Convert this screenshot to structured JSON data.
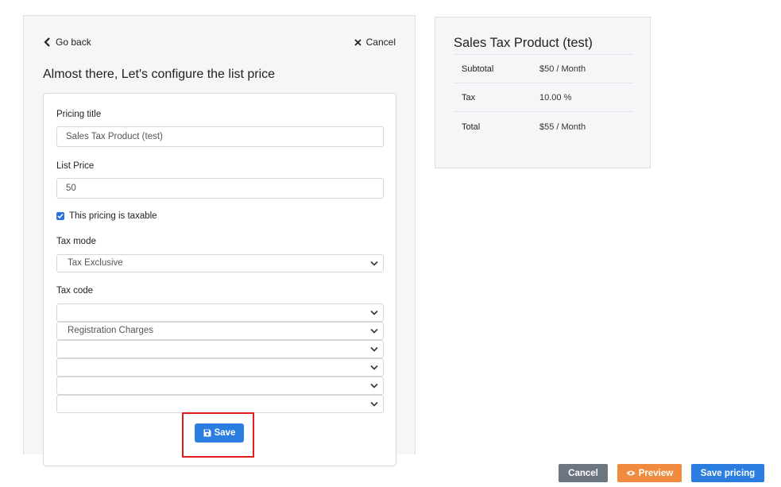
{
  "nav": {
    "go_back": "Go back",
    "cancel": "Cancel"
  },
  "page_title": "Almost there, Let's configure the list price",
  "form": {
    "pricing_title_label": "Pricing title",
    "pricing_title_value": "Sales Tax Product (test)",
    "list_price_label": "List Price",
    "list_price_value": "50",
    "taxable_label": "This pricing is taxable",
    "taxable_checked": true,
    "tax_mode_label": "Tax mode",
    "tax_mode_value": "Tax Exclusive",
    "tax_code_label": "Tax code",
    "tax_codes": [
      "",
      "Registration Charges",
      "",
      "",
      "",
      ""
    ],
    "save_label": "Save"
  },
  "summary": {
    "title": "Sales Tax Product (test)",
    "rows": [
      {
        "label": "Subtotal",
        "value": "$50 / Month"
      },
      {
        "label": "Tax",
        "value": "10.00 %"
      },
      {
        "label": "Total",
        "value": "$55 / Month"
      }
    ]
  },
  "footer": {
    "cancel": "Cancel",
    "preview": "Preview",
    "save_pricing": "Save pricing"
  },
  "colors": {
    "primary": "#2b7de0",
    "preview": "#f08a3e",
    "cancel": "#6c7680",
    "highlight": "#e01b1b"
  }
}
